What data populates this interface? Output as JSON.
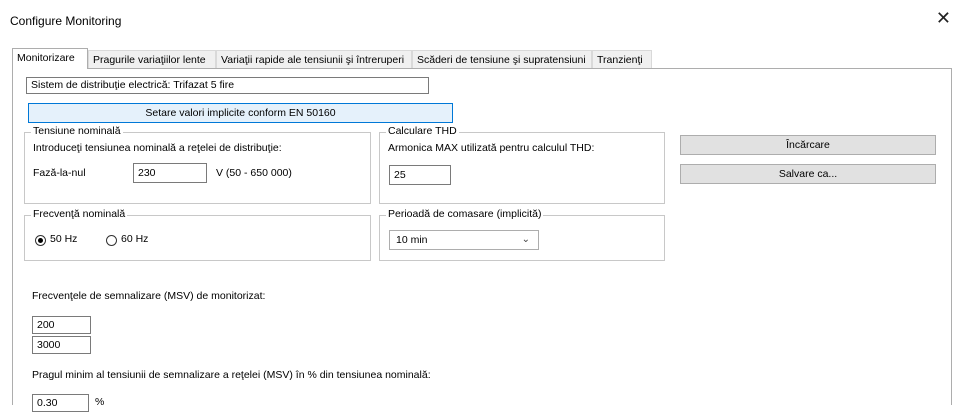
{
  "window": {
    "title": "Configure Monitoring",
    "close_glyph": "✕"
  },
  "tabs": [
    {
      "label": "Monitorizare"
    },
    {
      "label": "Pragurile variaţiilor lente"
    },
    {
      "label": "Variaţii rapide ale tensiunii şi întreruperi"
    },
    {
      "label": "Scăderi de tensiune şi supratensiuni"
    },
    {
      "label": "Tranzienţi"
    }
  ],
  "distribution_system": "Sistem de distribuţie electrică: Trifazat 5 fire",
  "set_defaults_button": "Setare valori implicite conform EN 50160",
  "nominal_voltage": {
    "legend": "Tensiune nominală",
    "prompt": "Introduceţi tensiunea nominală a reţelei de distribuţie:",
    "label": "Fază-la-nul",
    "value": "230",
    "unit": "V (50 - 650 000)"
  },
  "thd": {
    "legend": "Calculare THD",
    "prompt": "Armonica MAX utilizată pentru calculul THD:",
    "value": "25"
  },
  "buttons": {
    "load": "Încărcare",
    "save_as": "Salvare ca..."
  },
  "nominal_frequency": {
    "legend": "Frecvenţă nominală",
    "option_50": "50 Hz",
    "option_60": "60 Hz",
    "selected": "50 Hz"
  },
  "aggregation": {
    "legend": "Perioadă de comasare (implicită)",
    "selected": "10 min"
  },
  "msv": {
    "label": "Frecvenţele de semnalizare (MSV) de monitorizat:",
    "freq1": "200",
    "freq2": "3000",
    "threshold_label": "Pragul minim al tensiunii de semnalizare a reţelei (MSV) în % din tensiunea nominală:",
    "threshold_value": "0.30",
    "threshold_unit": "%"
  },
  "icons": {
    "close": "close-icon",
    "dropdown": "chevron-down-icon",
    "radio": "radio-icon"
  },
  "colors": {
    "primary_button_border": "#0078d7",
    "primary_button_bg": "#e5f1fb"
  }
}
